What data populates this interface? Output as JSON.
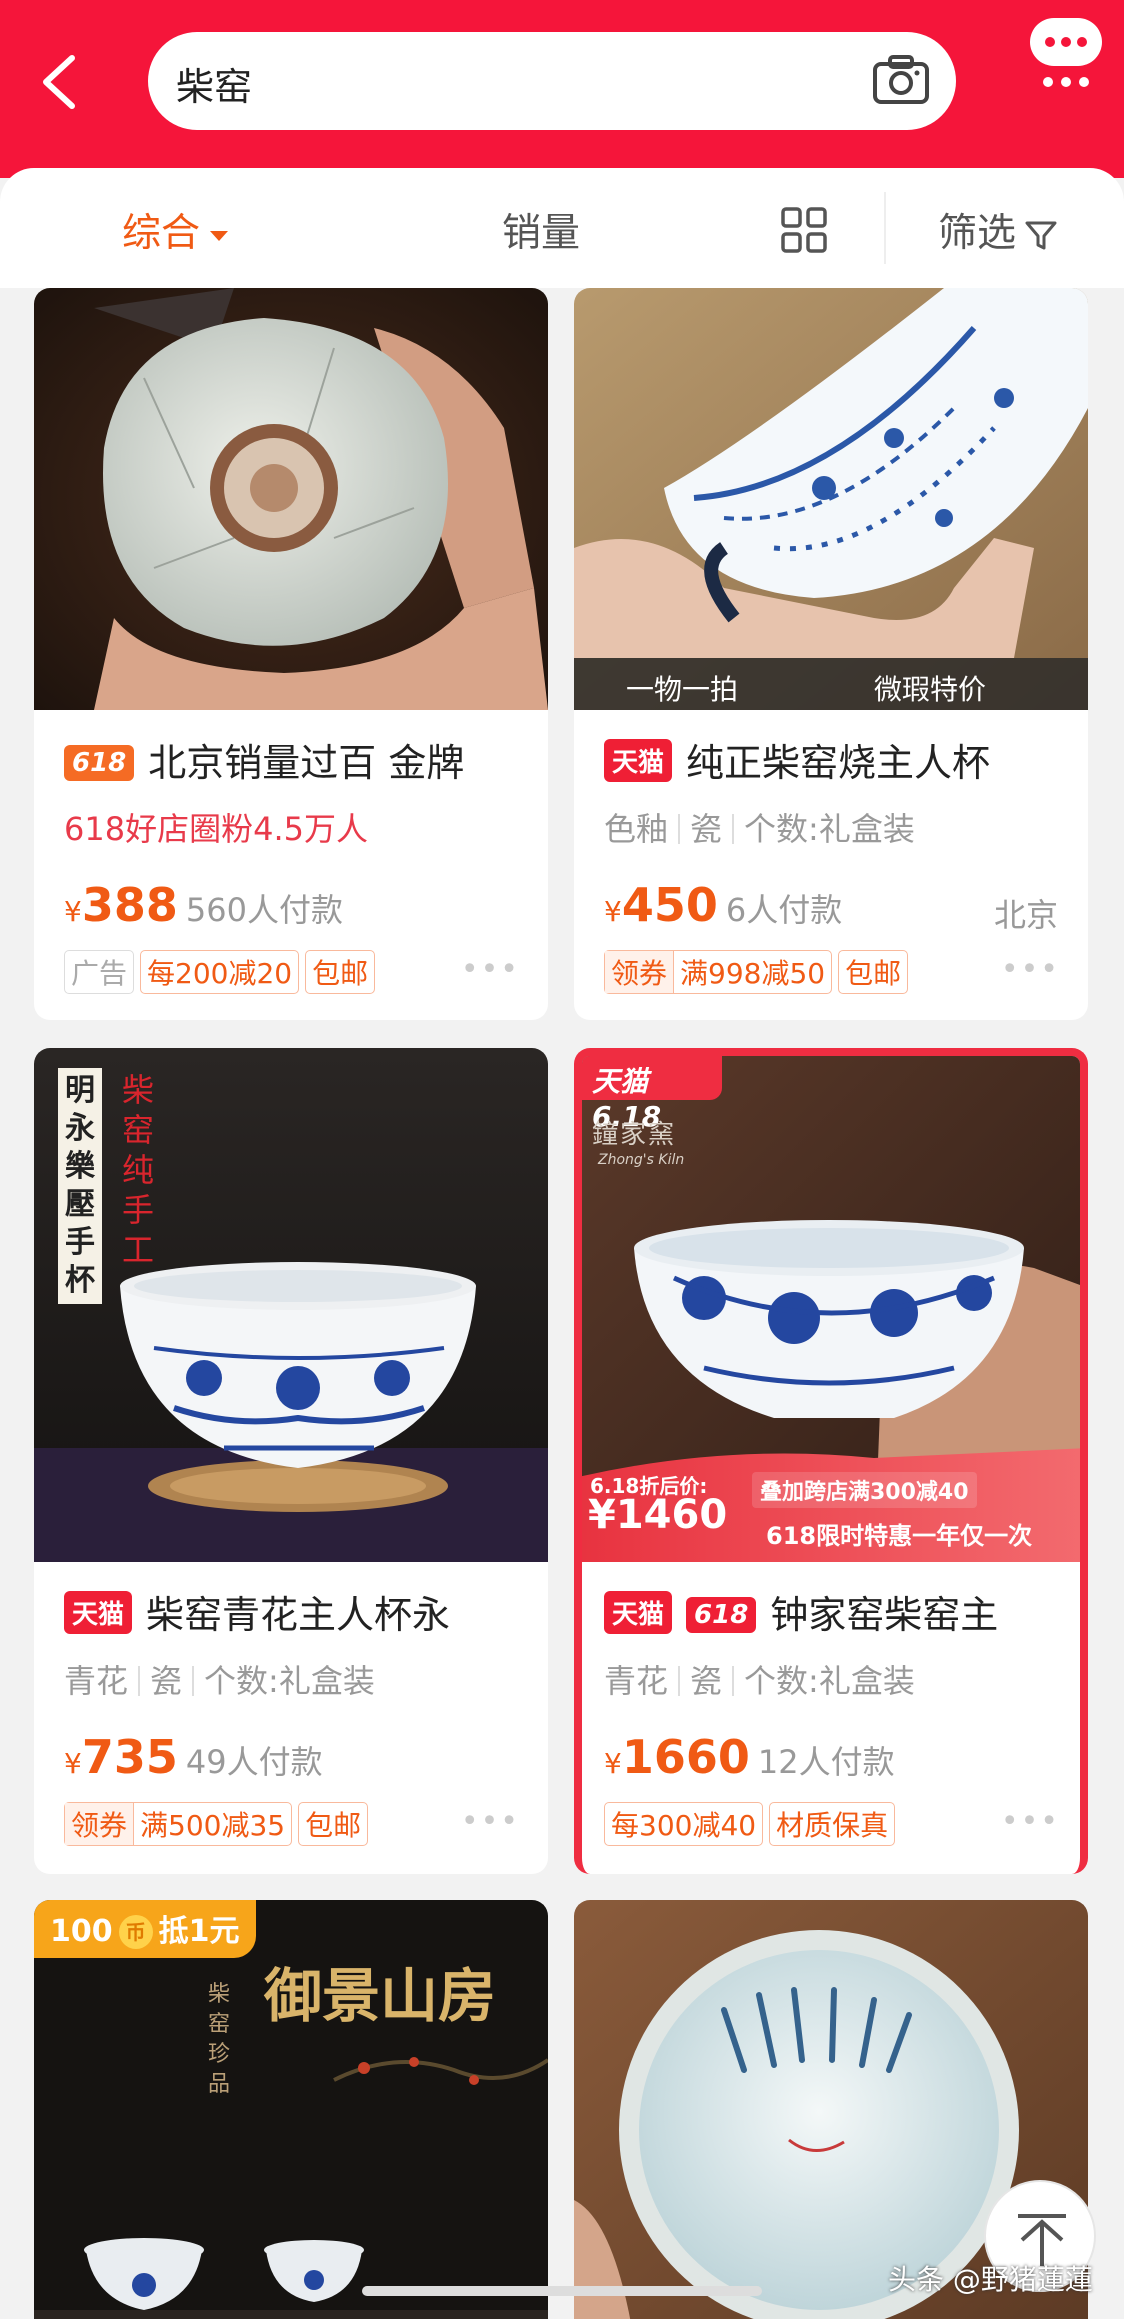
{
  "search": {
    "query": "柴窑"
  },
  "filters": {
    "sort": "综合",
    "sales": "销量",
    "filter": "筛选"
  },
  "products": [
    {
      "tag": "618",
      "title": "北京销量过百 金牌",
      "sub": "618好店圈粉4.5万人",
      "yen": "¥",
      "price": "388",
      "paid": "560人付款",
      "chips": [
        "广告",
        "每200减20",
        "包邮"
      ]
    },
    {
      "tag": "天猫",
      "title": "纯正柴窑烧主人杯",
      "sub": [
        "色釉",
        "瓷",
        "个数:礼盒装"
      ],
      "yen": "¥",
      "price": "450",
      "paid": "6人付款",
      "location": "北京",
      "coupon": "领券",
      "chips": [
        "满998减50",
        "包邮"
      ],
      "img_bar": [
        "一物一拍",
        "微瑕特价"
      ]
    },
    {
      "tag": "天猫",
      "title": "柴窑青花主人杯永",
      "sub": [
        "青花",
        "瓷",
        "个数:礼盒装"
      ],
      "yen": "¥",
      "price": "735",
      "paid": "49人付款",
      "coupon": "领券",
      "chips": [
        "满500减35",
        "包邮"
      ],
      "img_text": "明永樂壓手杯",
      "img_text2": "柴窑纯手工"
    },
    {
      "tags": [
        "天猫",
        "618"
      ],
      "title": "钟家窑柴窑主",
      "sub": [
        "青花",
        "瓷",
        "个数:礼盒装"
      ],
      "yen": "¥",
      "price": "1660",
      "paid": "12人付款",
      "chips": [
        "每300减40",
        "材质保真"
      ],
      "img_badge": "天猫6.18",
      "img_brand": "鐘家窯",
      "img_brand_en": "Zhong's Kiln",
      "promo_label": "6.18折后价:",
      "promo_price": "¥1460",
      "promo_1": "叠加跨店满300减40",
      "promo_2": "618限时特惠一年仅一次"
    },
    {
      "img_badge": "100",
      "coin": "币",
      "img_badge_2": "抵1元",
      "img_text": "御景山房",
      "img_text2": "柴窑珍品"
    },
    {}
  ],
  "watermark": "头条 @野猪蓮蓮",
  "colors": {
    "brand": "#f5153a",
    "accent": "#f05a14"
  }
}
